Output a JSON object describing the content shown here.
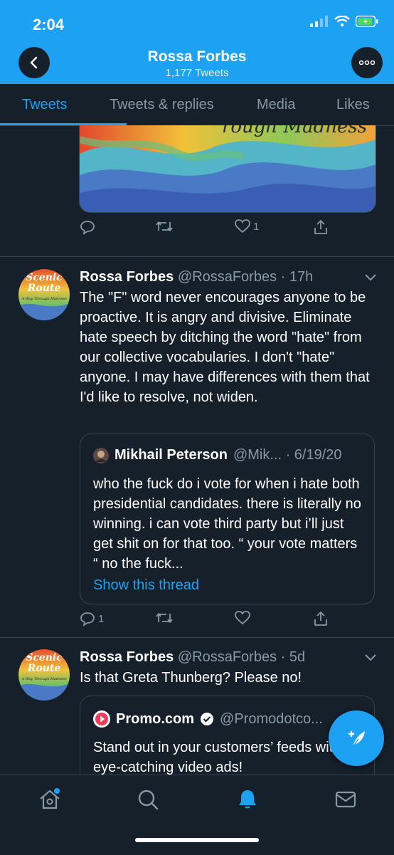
{
  "status_bar": {
    "time": "2:04"
  },
  "header": {
    "title": "Rossa Forbes",
    "subtitle": "1,177 Tweets"
  },
  "tabs": [
    {
      "label": "Tweets",
      "active": true
    },
    {
      "label": "Tweets & replies"
    },
    {
      "label": "Media"
    },
    {
      "label": "Likes"
    }
  ],
  "top_tweet": {
    "media_text": "rough Madness",
    "actions": {
      "reply_count": "",
      "retweet_count": "",
      "like_count": "1"
    }
  },
  "tweets": [
    {
      "avatar_text": [
        "Scenic",
        "Route",
        "A Way Through Madness"
      ],
      "name": "Rossa Forbes",
      "handle_meta": "@RossaForbes · 17h",
      "text": "The \"F\" word never encourages anyone to be proactive. It is angry and divisive. Eliminate hate speech by ditching the word \"hate\" from our collective vocabularies. I don't \"hate\" anyone. I may have differences with them that I'd like to resolve, not widen.",
      "quote": {
        "name": "Mikhail Peterson",
        "handle_meta": "@Mik... · 6/19/20",
        "text": "who the fuck do i vote for when i hate both presidential candidates. there is literally no winning. i can vote third party but i’ll just get shit on for that too. “ your vote matters “ no the fuck...",
        "link": "Show this thread"
      },
      "actions": {
        "reply_count": "1",
        "retweet_count": "",
        "like_count": ""
      }
    },
    {
      "avatar_text": [
        "Scenic",
        "Route",
        "A Way Through Madness"
      ],
      "name": "Rossa Forbes",
      "handle_meta": "@RossaForbes · 5d",
      "text": "Is that Greta Thunberg? Please no!",
      "quote": {
        "name": "Promo.com",
        "handle_meta": "@Promodotco...",
        "text": "Stand out in your customers’ feeds with eye-catching video ads!"
      }
    }
  ],
  "icons": {
    "back": "arrow-left-icon",
    "more": "ellipsis-icon",
    "reply": "reply-icon",
    "retweet": "retweet-icon",
    "like": "heart-icon",
    "share": "share-icon",
    "home": "home-icon",
    "search": "search-icon",
    "notifications": "bell-icon",
    "messages": "mail-icon",
    "compose": "compose-icon"
  },
  "colors": {
    "accent": "#1da1f2",
    "background": "#15202b",
    "border": "#38444d",
    "muted": "#8899a6"
  }
}
